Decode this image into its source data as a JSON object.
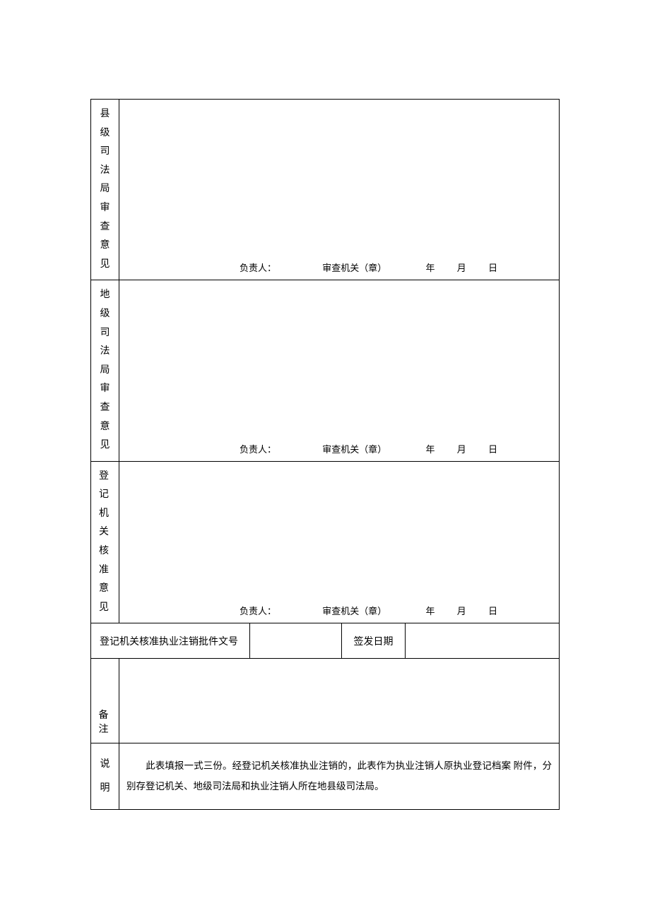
{
  "rows": {
    "county": {
      "label_chars": [
        "县",
        "级",
        "司",
        "法",
        "局",
        "审",
        "查",
        "意",
        "见"
      ],
      "responsible": "负责人：",
      "org": "审查机关（章）",
      "y": "年",
      "m": "月",
      "d": "日"
    },
    "prefecture": {
      "label_chars": [
        "地",
        "级",
        "司",
        "法",
        "局",
        "审",
        "查",
        "意",
        "见"
      ],
      "responsible": "负责人：",
      "org": "审查机关（章）",
      "y": "年",
      "m": "月",
      "d": "日"
    },
    "registration": {
      "label_pairs": [
        "登 记",
        "机 关",
        "核 准",
        "意 见"
      ],
      "responsible": "负责人：",
      "org": "审查机关（章）",
      "y": "年",
      "m": "月",
      "d": "日"
    },
    "docno": {
      "label": "登记机关核准执业注销批件文号",
      "issue_label": "签发日期",
      "doc_value": "",
      "issue_value": ""
    },
    "remark": {
      "label": "备 注"
    },
    "explain": {
      "label_chars": [
        "说",
        "明"
      ],
      "text": "此表填报一式三份。经登记机关核准执业注销的，此表作为执业注销人原执业登记档案 附件，分别存登记机关、地级司法局和执业注销人所在地县级司法局。"
    }
  }
}
